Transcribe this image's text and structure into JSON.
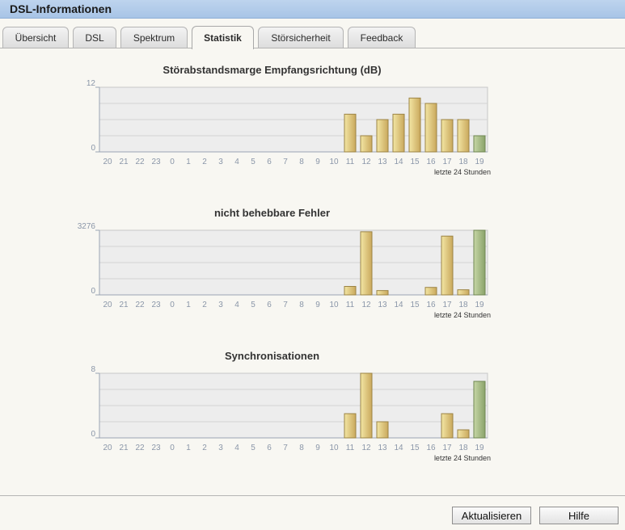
{
  "window": {
    "title": "DSL-Informationen"
  },
  "tabs": [
    {
      "label": "Übersicht",
      "active": false
    },
    {
      "label": "DSL",
      "active": false
    },
    {
      "label": "Spektrum",
      "active": false
    },
    {
      "label": "Statistik",
      "active": true
    },
    {
      "label": "Störsicherheit",
      "active": false
    },
    {
      "label": "Feedback",
      "active": false
    }
  ],
  "colors": {
    "bar_gradient": [
      "#f3e6a4",
      "#c9a85c"
    ],
    "bar_current_gradient": [
      "#c6d6a6",
      "#8aa36a"
    ],
    "plot_background": "#ededed",
    "axis_label": "#8a96a8"
  },
  "chart_data": [
    {
      "type": "bar",
      "title": "Störabstandsmarge Empfangsrichtung (dB)",
      "categories": [
        "20",
        "21",
        "22",
        "23",
        "0",
        "1",
        "2",
        "3",
        "4",
        "5",
        "6",
        "7",
        "8",
        "9",
        "10",
        "11",
        "12",
        "13",
        "14",
        "15",
        "16",
        "17",
        "18",
        "19"
      ],
      "values": [
        0,
        0,
        0,
        0,
        0,
        0,
        0,
        0,
        0,
        0,
        0,
        0,
        0,
        0,
        0,
        7,
        3,
        6,
        7,
        10,
        9,
        6,
        6,
        3
      ],
      "ylim": [
        0,
        12
      ],
      "yticks": [
        "0",
        "12"
      ],
      "xlabel": "letzte 24 Stunden",
      "grid": true,
      "current_index": 23
    },
    {
      "type": "bar",
      "title": "nicht behebbare Fehler",
      "categories": [
        "20",
        "21",
        "22",
        "23",
        "0",
        "1",
        "2",
        "3",
        "4",
        "5",
        "6",
        "7",
        "8",
        "9",
        "10",
        "11",
        "12",
        "13",
        "14",
        "15",
        "16",
        "17",
        "18",
        "19"
      ],
      "values": [
        0,
        0,
        0,
        0,
        0,
        0,
        0,
        0,
        0,
        0,
        0,
        0,
        0,
        0,
        0,
        430,
        3200,
        220,
        0,
        0,
        380,
        2980,
        260,
        3350
      ],
      "ylim": [
        0,
        3276
      ],
      "yticks": [
        "0",
        "3276"
      ],
      "xlabel": "letzte 24 Stunden",
      "grid": true,
      "current_index": 23
    },
    {
      "type": "bar",
      "title": "Synchronisationen",
      "categories": [
        "20",
        "21",
        "22",
        "23",
        "0",
        "1",
        "2",
        "3",
        "4",
        "5",
        "6",
        "7",
        "8",
        "9",
        "10",
        "11",
        "12",
        "13",
        "14",
        "15",
        "16",
        "17",
        "18",
        "19"
      ],
      "values": [
        0,
        0,
        0,
        0,
        0,
        0,
        0,
        0,
        0,
        0,
        0,
        0,
        0,
        0,
        0,
        3,
        8,
        2,
        0,
        0,
        0,
        3,
        1,
        7
      ],
      "ylim": [
        0,
        8
      ],
      "yticks": [
        "0",
        "8"
      ],
      "xlabel": "letzte 24 Stunden",
      "grid": true,
      "current_index": 23
    }
  ],
  "buttons": {
    "refresh": "Aktualisieren",
    "help": "Hilfe"
  }
}
